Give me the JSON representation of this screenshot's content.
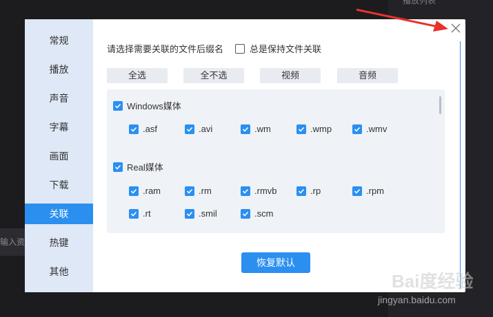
{
  "background": {
    "top_right_label": "播放列表",
    "left_input_text": "输入资源"
  },
  "watermark": {
    "brand": "Bai度经验",
    "url": "jingyan.baidu.com"
  },
  "nav": {
    "items": [
      {
        "label": "常规"
      },
      {
        "label": "播放"
      },
      {
        "label": "声音"
      },
      {
        "label": "字幕"
      },
      {
        "label": "画面"
      },
      {
        "label": "下载"
      },
      {
        "label": "关联"
      },
      {
        "label": "热键"
      },
      {
        "label": "其他"
      }
    ],
    "active_index": 6
  },
  "content": {
    "prompt": "请选择需要关联的文件后缀名",
    "always_keep_label": "总是保持文件关联",
    "buttons": {
      "select_all": "全选",
      "select_none": "全不选",
      "video": "视频",
      "audio": "音频"
    },
    "windows_group": {
      "label": "Windows媒体",
      "items": [
        ".asf",
        ".avi",
        ".wm",
        ".wmp",
        ".wmv"
      ]
    },
    "real_group": {
      "label": "Real媒体",
      "items": [
        ".ram",
        ".rm",
        ".rmvb",
        ".rp",
        ".rpm",
        ".rt",
        ".smil",
        ".scm"
      ]
    },
    "restore_label": "恢复默认"
  },
  "colors": {
    "accent": "#2b8ff0",
    "nav_bg": "#dfe8f6",
    "annotation_arrow": "#e8322d"
  }
}
